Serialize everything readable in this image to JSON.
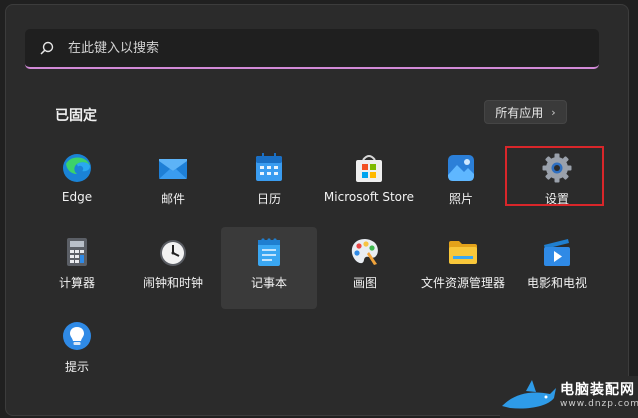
{
  "search": {
    "placeholder": "在此键入以搜索"
  },
  "pinned": {
    "title": "已固定",
    "all_apps_label": "所有应用"
  },
  "apps": [
    {
      "label": "Edge",
      "icon": "edge-icon"
    },
    {
      "label": "邮件",
      "icon": "mail-icon"
    },
    {
      "label": "日历",
      "icon": "calendar-icon"
    },
    {
      "label": "Microsoft Store",
      "icon": "store-icon"
    },
    {
      "label": "照片",
      "icon": "photos-icon"
    },
    {
      "label": "设置",
      "icon": "settings-gear-icon"
    },
    {
      "label": "计算器",
      "icon": "calculator-icon"
    },
    {
      "label": "闹钟和时钟",
      "icon": "clock-icon"
    },
    {
      "label": "记事本",
      "icon": "notepad-icon"
    },
    {
      "label": "画图",
      "icon": "paint-palette-icon"
    },
    {
      "label": "文件资源管理器",
      "icon": "folder-icon"
    },
    {
      "label": "电影和电视",
      "icon": "movies-tv-icon"
    },
    {
      "label": "提示",
      "icon": "tips-lightbulb-icon"
    }
  ],
  "watermark": {
    "text": "电脑装配网",
    "sub": "www.dnzp.com"
  },
  "colors": {
    "accent_underline": "#d28ad8",
    "highlight_box": "#d9262a",
    "menu_bg": "#2b2b2b"
  }
}
